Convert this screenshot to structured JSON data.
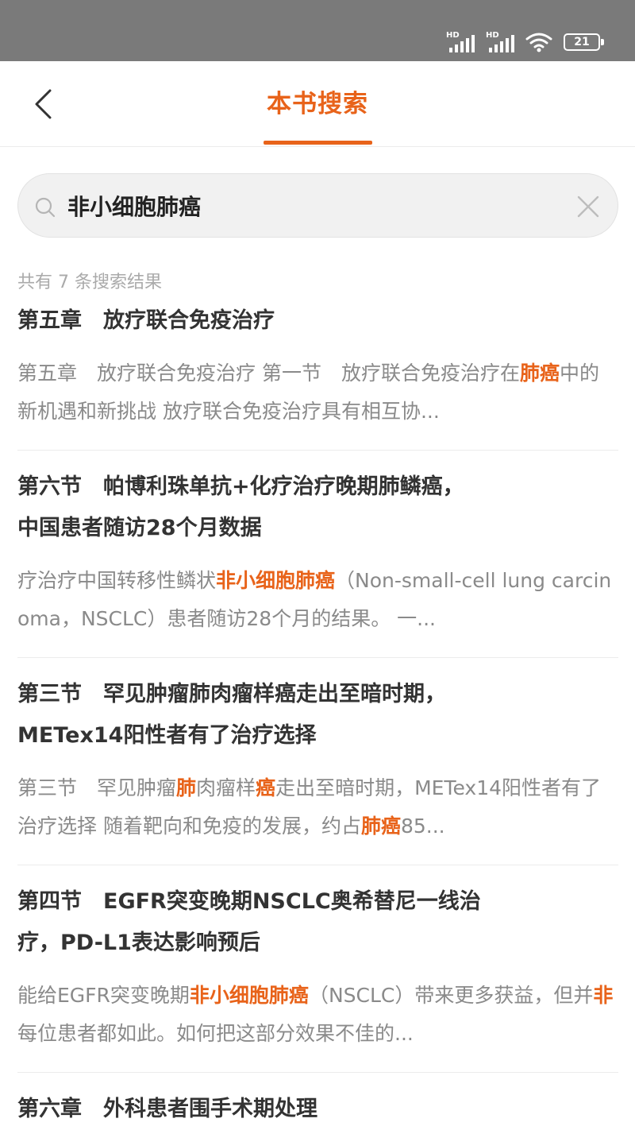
{
  "status": {
    "hd1": "HD",
    "hd2": "HD",
    "battery": "21"
  },
  "header": {
    "title": "本书搜索"
  },
  "search": {
    "query": "非小细胞肺癌"
  },
  "result_count": "共有 7 条搜索结果",
  "results": [
    {
      "title": "第五章　放疗联合免疫治疗",
      "snippet": [
        {
          "t": "第五章　放疗联合免疫治疗 第一节　放疗联合免疫治疗在"
        },
        {
          "t": "肺癌",
          "h": true
        },
        {
          "t": "中的新机遇和新挑战 放疗联合免疫治疗具有相互协..."
        }
      ]
    },
    {
      "title": "第六节　帕博利珠单抗+化疗治疗晚期肺鳞癌，\n中国患者随访28个月数据",
      "snippet": [
        {
          "t": "疗治疗中国转移性鳞状"
        },
        {
          "t": "非小细胞肺癌",
          "h": true
        },
        {
          "t": "（Non-small-cell lung carcinoma，NSCLC）患者随访28个月的结果。 一..."
        }
      ]
    },
    {
      "title": "第三节　罕见肿瘤肺肉瘤样癌走出至暗时期，\nMETex14阳性者有了治疗选择",
      "snippet": [
        {
          "t": "第三节　罕见肿瘤"
        },
        {
          "t": "肺",
          "h": true
        },
        {
          "t": "肉瘤样"
        },
        {
          "t": "癌",
          "h": true
        },
        {
          "t": "走出至暗时期，METex14阳性者有了治疗选择 随着靶向和免疫的发展，约占"
        },
        {
          "t": "肺癌",
          "h": true
        },
        {
          "t": "85..."
        }
      ]
    },
    {
      "title": "第四节　EGFR突变晚期NSCLC奥希替尼一线治\n疗，PD-L1表达影响预后",
      "snippet": [
        {
          "t": "能给EGFR突变晚期"
        },
        {
          "t": "非小细胞肺癌",
          "h": true
        },
        {
          "t": "（NSCLC）带来更多获益，但并"
        },
        {
          "t": "非",
          "h": true
        },
        {
          "t": "每位患者都如此。如何把这部分效果不佳的..."
        }
      ]
    },
    {
      "title": "第六章　外科患者围手术期处理",
      "snippet": []
    }
  ],
  "colors": {
    "accent": "#e8631a",
    "status_bar": "#7a7a7a"
  }
}
